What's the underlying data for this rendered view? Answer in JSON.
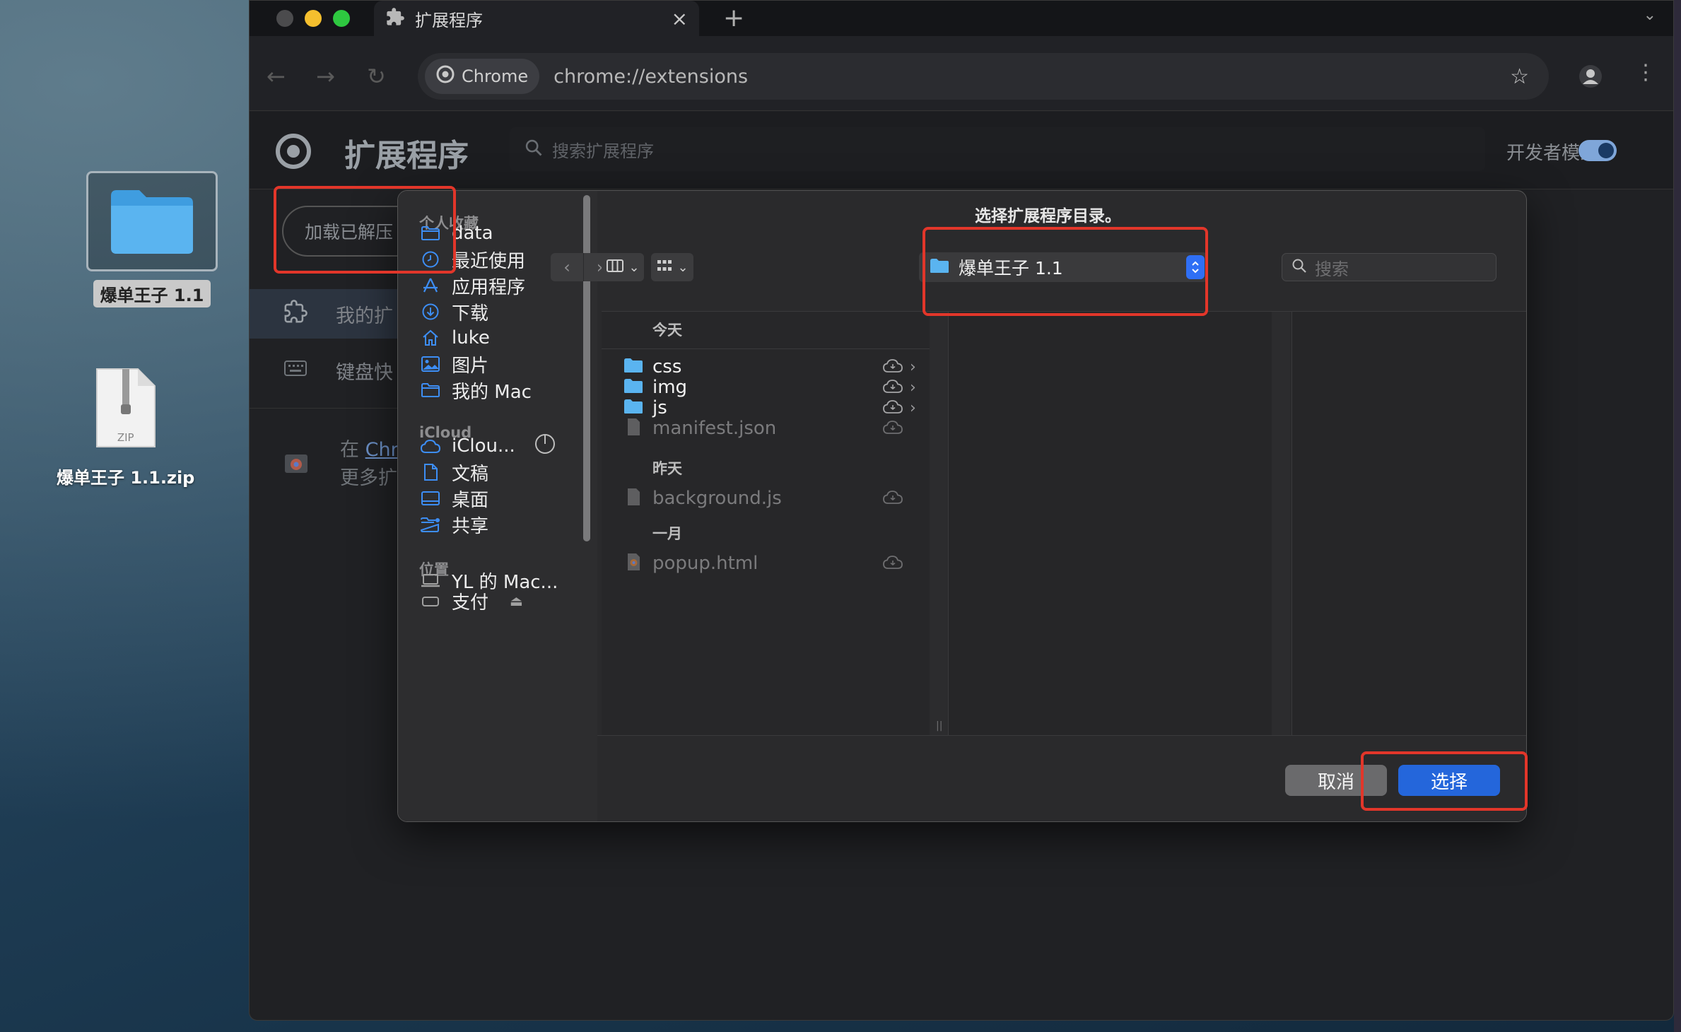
{
  "desktop": {
    "folder_label": "爆单王子 1.1",
    "zip_label": "爆单王子 1.1.zip",
    "zip_badge": "ZIP"
  },
  "chrome": {
    "tab_title": "扩展程序",
    "omnibox_chip": "Chrome",
    "url": "chrome://extensions"
  },
  "extensions_page": {
    "title": "扩展程序",
    "search_placeholder": "搜索扩展程序",
    "developer_mode_label": "开发者模式",
    "load_unpacked_button": "加载已解压",
    "sidebar": {
      "my_extensions": "我的扩",
      "keyboard_shortcuts": "键盘快"
    },
    "store_text_prefix": "在 ",
    "store_link": "Chr",
    "store_text_line2": "更多扩"
  },
  "dialog": {
    "title": "选择扩展程序目录。",
    "sidebar": {
      "favorites_header": "个人收藏",
      "favorites": [
        "data",
        "最近使用",
        "应用程序",
        "下载",
        "luke",
        "图片",
        "我的 Mac"
      ],
      "icloud_header": "iCloud",
      "icloud": [
        "iClou...",
        "文稿",
        "桌面",
        "共享"
      ],
      "locations_header": "位置",
      "locations": [
        "YL 的 Mac...",
        "支付"
      ]
    },
    "path_popup": "爆单王子 1.1",
    "search_placeholder": "搜索",
    "groups": {
      "today": "今天",
      "yesterday": "昨天",
      "january": "一月"
    },
    "files": {
      "today": [
        "css",
        "img",
        "js",
        "manifest.json"
      ],
      "yesterday": [
        "background.js"
      ],
      "january": [
        "popup.html"
      ]
    },
    "cancel_button": "取消",
    "choose_button": "选择"
  },
  "colors": {
    "accent_blue": "#2466db",
    "highlight_red": "#e2362a",
    "folder_blue": "#5ab4f0"
  }
}
